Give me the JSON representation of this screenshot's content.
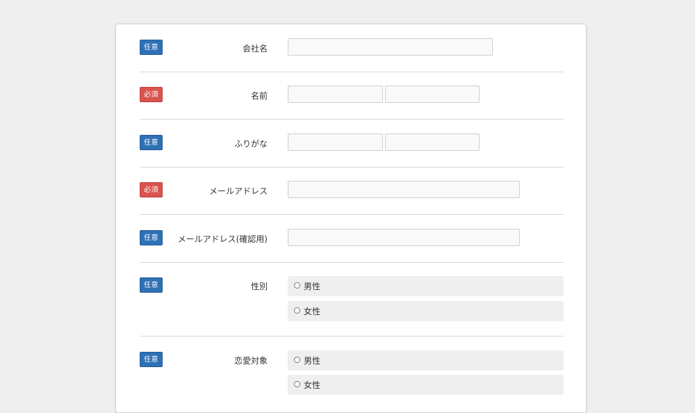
{
  "badges": {
    "optional": "任意",
    "required": "必須"
  },
  "colors": {
    "optional_badge": "#2f71b6",
    "required_badge": "#d9534f",
    "background": "#efefef"
  },
  "fields": {
    "company": {
      "label": "会社名",
      "badge": "任意",
      "value": ""
    },
    "name": {
      "label": "名前",
      "badge": "必須",
      "value_last": "",
      "value_first": ""
    },
    "furigana": {
      "label": "ふりがな",
      "badge": "任意",
      "value_last": "",
      "value_first": ""
    },
    "email": {
      "label": "メールアドレス",
      "badge": "必須",
      "value": ""
    },
    "email_confirm": {
      "label": "メールアドレス(確認用)",
      "badge": "任意",
      "value": ""
    },
    "gender": {
      "label": "性別",
      "badge": "任意",
      "options": [
        "男性",
        "女性"
      ]
    },
    "love_target": {
      "label": "恋愛対象",
      "badge": "任意",
      "options": [
        "男性",
        "女性"
      ]
    }
  }
}
